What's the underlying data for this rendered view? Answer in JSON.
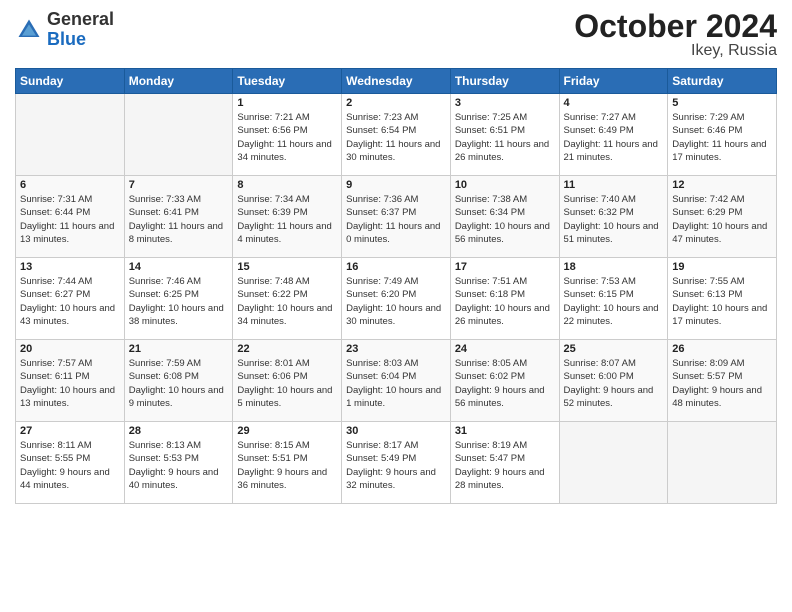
{
  "logo": {
    "general": "General",
    "blue": "Blue"
  },
  "header": {
    "month": "October 2024",
    "location": "Ikey, Russia"
  },
  "weekdays": [
    "Sunday",
    "Monday",
    "Tuesday",
    "Wednesday",
    "Thursday",
    "Friday",
    "Saturday"
  ],
  "weeks": [
    [
      {
        "day": "",
        "empty": true
      },
      {
        "day": "",
        "empty": true
      },
      {
        "day": "1",
        "sunrise": "Sunrise: 7:21 AM",
        "sunset": "Sunset: 6:56 PM",
        "daylight": "Daylight: 11 hours and 34 minutes."
      },
      {
        "day": "2",
        "sunrise": "Sunrise: 7:23 AM",
        "sunset": "Sunset: 6:54 PM",
        "daylight": "Daylight: 11 hours and 30 minutes."
      },
      {
        "day": "3",
        "sunrise": "Sunrise: 7:25 AM",
        "sunset": "Sunset: 6:51 PM",
        "daylight": "Daylight: 11 hours and 26 minutes."
      },
      {
        "day": "4",
        "sunrise": "Sunrise: 7:27 AM",
        "sunset": "Sunset: 6:49 PM",
        "daylight": "Daylight: 11 hours and 21 minutes."
      },
      {
        "day": "5",
        "sunrise": "Sunrise: 7:29 AM",
        "sunset": "Sunset: 6:46 PM",
        "daylight": "Daylight: 11 hours and 17 minutes."
      }
    ],
    [
      {
        "day": "6",
        "sunrise": "Sunrise: 7:31 AM",
        "sunset": "Sunset: 6:44 PM",
        "daylight": "Daylight: 11 hours and 13 minutes."
      },
      {
        "day": "7",
        "sunrise": "Sunrise: 7:33 AM",
        "sunset": "Sunset: 6:41 PM",
        "daylight": "Daylight: 11 hours and 8 minutes."
      },
      {
        "day": "8",
        "sunrise": "Sunrise: 7:34 AM",
        "sunset": "Sunset: 6:39 PM",
        "daylight": "Daylight: 11 hours and 4 minutes."
      },
      {
        "day": "9",
        "sunrise": "Sunrise: 7:36 AM",
        "sunset": "Sunset: 6:37 PM",
        "daylight": "Daylight: 11 hours and 0 minutes."
      },
      {
        "day": "10",
        "sunrise": "Sunrise: 7:38 AM",
        "sunset": "Sunset: 6:34 PM",
        "daylight": "Daylight: 10 hours and 56 minutes."
      },
      {
        "day": "11",
        "sunrise": "Sunrise: 7:40 AM",
        "sunset": "Sunset: 6:32 PM",
        "daylight": "Daylight: 10 hours and 51 minutes."
      },
      {
        "day": "12",
        "sunrise": "Sunrise: 7:42 AM",
        "sunset": "Sunset: 6:29 PM",
        "daylight": "Daylight: 10 hours and 47 minutes."
      }
    ],
    [
      {
        "day": "13",
        "sunrise": "Sunrise: 7:44 AM",
        "sunset": "Sunset: 6:27 PM",
        "daylight": "Daylight: 10 hours and 43 minutes."
      },
      {
        "day": "14",
        "sunrise": "Sunrise: 7:46 AM",
        "sunset": "Sunset: 6:25 PM",
        "daylight": "Daylight: 10 hours and 38 minutes."
      },
      {
        "day": "15",
        "sunrise": "Sunrise: 7:48 AM",
        "sunset": "Sunset: 6:22 PM",
        "daylight": "Daylight: 10 hours and 34 minutes."
      },
      {
        "day": "16",
        "sunrise": "Sunrise: 7:49 AM",
        "sunset": "Sunset: 6:20 PM",
        "daylight": "Daylight: 10 hours and 30 minutes."
      },
      {
        "day": "17",
        "sunrise": "Sunrise: 7:51 AM",
        "sunset": "Sunset: 6:18 PM",
        "daylight": "Daylight: 10 hours and 26 minutes."
      },
      {
        "day": "18",
        "sunrise": "Sunrise: 7:53 AM",
        "sunset": "Sunset: 6:15 PM",
        "daylight": "Daylight: 10 hours and 22 minutes."
      },
      {
        "day": "19",
        "sunrise": "Sunrise: 7:55 AM",
        "sunset": "Sunset: 6:13 PM",
        "daylight": "Daylight: 10 hours and 17 minutes."
      }
    ],
    [
      {
        "day": "20",
        "sunrise": "Sunrise: 7:57 AM",
        "sunset": "Sunset: 6:11 PM",
        "daylight": "Daylight: 10 hours and 13 minutes."
      },
      {
        "day": "21",
        "sunrise": "Sunrise: 7:59 AM",
        "sunset": "Sunset: 6:08 PM",
        "daylight": "Daylight: 10 hours and 9 minutes."
      },
      {
        "day": "22",
        "sunrise": "Sunrise: 8:01 AM",
        "sunset": "Sunset: 6:06 PM",
        "daylight": "Daylight: 10 hours and 5 minutes."
      },
      {
        "day": "23",
        "sunrise": "Sunrise: 8:03 AM",
        "sunset": "Sunset: 6:04 PM",
        "daylight": "Daylight: 10 hours and 1 minute."
      },
      {
        "day": "24",
        "sunrise": "Sunrise: 8:05 AM",
        "sunset": "Sunset: 6:02 PM",
        "daylight": "Daylight: 9 hours and 56 minutes."
      },
      {
        "day": "25",
        "sunrise": "Sunrise: 8:07 AM",
        "sunset": "Sunset: 6:00 PM",
        "daylight": "Daylight: 9 hours and 52 minutes."
      },
      {
        "day": "26",
        "sunrise": "Sunrise: 8:09 AM",
        "sunset": "Sunset: 5:57 PM",
        "daylight": "Daylight: 9 hours and 48 minutes."
      }
    ],
    [
      {
        "day": "27",
        "sunrise": "Sunrise: 8:11 AM",
        "sunset": "Sunset: 5:55 PM",
        "daylight": "Daylight: 9 hours and 44 minutes."
      },
      {
        "day": "28",
        "sunrise": "Sunrise: 8:13 AM",
        "sunset": "Sunset: 5:53 PM",
        "daylight": "Daylight: 9 hours and 40 minutes."
      },
      {
        "day": "29",
        "sunrise": "Sunrise: 8:15 AM",
        "sunset": "Sunset: 5:51 PM",
        "daylight": "Daylight: 9 hours and 36 minutes."
      },
      {
        "day": "30",
        "sunrise": "Sunrise: 8:17 AM",
        "sunset": "Sunset: 5:49 PM",
        "daylight": "Daylight: 9 hours and 32 minutes."
      },
      {
        "day": "31",
        "sunrise": "Sunrise: 8:19 AM",
        "sunset": "Sunset: 5:47 PM",
        "daylight": "Daylight: 9 hours and 28 minutes."
      },
      {
        "day": "",
        "empty": true
      },
      {
        "day": "",
        "empty": true
      }
    ]
  ]
}
